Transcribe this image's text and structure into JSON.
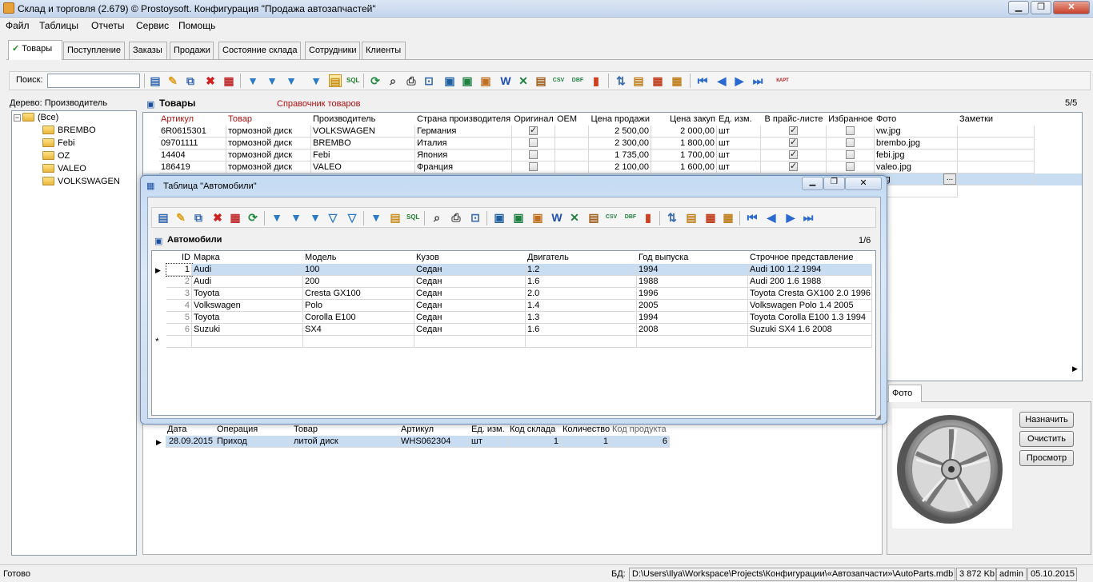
{
  "window": {
    "title": "Склад и торговля (2.679) © Prostoysoft. Конфигурация \"Продажа автозапчастей\""
  },
  "menu": [
    "Файл",
    "Таблицы",
    "Отчеты",
    "Сервис",
    "Помощь"
  ],
  "tabs": [
    "Товары",
    "Поступление",
    "Заказы",
    "Продажи",
    "Состояние склада",
    "Сотрудники",
    "Клиенты"
  ],
  "search": {
    "label": "Поиск:",
    "value": ""
  },
  "tree": {
    "title": "Дерево: Производитель",
    "root": "(Все)",
    "items": [
      "BREMBO",
      "Febi",
      "OZ",
      "VALEO",
      "VOLKSWAGEN"
    ]
  },
  "products": {
    "title": "Товары",
    "subtitle": "Справочник товаров",
    "count": "5/5",
    "columns": [
      "Артикул",
      "Товар",
      "Производитель",
      "Страна производителя",
      "Оригинал",
      "OEM",
      "Цена продажи",
      "Цена закуп",
      "Ед. изм.",
      "В прайс-листе",
      "Избранное",
      "Фото",
      "Заметки"
    ],
    "rows": [
      {
        "article": "6R0615301",
        "product": "тормозной диск",
        "maker": "VOLKSWAGEN",
        "country": "Германия",
        "original": true,
        "oem": "",
        "price": "2 500,00",
        "cost": "2 000,00",
        "unit": "шт",
        "pricelist": true,
        "fav": false,
        "photo": "vw.jpg",
        "notes": ""
      },
      {
        "article": "09701111",
        "product": "тормозной диск",
        "maker": "BREMBO",
        "country": "Италия",
        "original": false,
        "oem": "",
        "price": "2 300,00",
        "cost": "1 800,00",
        "unit": "шт",
        "pricelist": true,
        "fav": false,
        "photo": "brembo.jpg",
        "notes": ""
      },
      {
        "article": "14404",
        "product": "тормозной диск",
        "maker": "Febi",
        "country": "Япония",
        "original": false,
        "oem": "",
        "price": "1 735,00",
        "cost": "1 700,00",
        "unit": "шт",
        "pricelist": true,
        "fav": false,
        "photo": "febi.jpg",
        "notes": ""
      },
      {
        "article": "186419",
        "product": "тормозной диск",
        "maker": "VALEO",
        "country": "Франция",
        "original": false,
        "oem": "",
        "price": "2 100,00",
        "cost": "1 600,00",
        "unit": "шт",
        "pricelist": true,
        "fav": false,
        "photo": "valeo.jpg",
        "notes": ""
      },
      {
        "photo": ".jpg"
      }
    ],
    "browse_button": "..."
  },
  "dialog": {
    "title": "Таблица \"Автомобили\"",
    "grid_title": "Автомобили",
    "count": "1/6",
    "columns": [
      "ID",
      "Марка",
      "Модель",
      "Кузов",
      "Двигатель",
      "Год выпуска",
      "Строчное представление"
    ],
    "rows": [
      {
        "id": "1",
        "brand": "Audi",
        "model": "100",
        "body": "Седан",
        "engine": "1.2",
        "year": "1994",
        "repr": "Audi 100 1.2 1994"
      },
      {
        "id": "2",
        "brand": "Audi",
        "model": "200",
        "body": "Седан",
        "engine": "1.6",
        "year": "1988",
        "repr": "Audi 200 1.6 1988"
      },
      {
        "id": "3",
        "brand": "Toyota",
        "model": "Cresta GX100",
        "body": "Седан",
        "engine": "2.0",
        "year": "1996",
        "repr": "Toyota Cresta GX100 2.0 1996"
      },
      {
        "id": "4",
        "brand": "Volkswagen",
        "model": "Polo",
        "body": "Седан",
        "engine": "1.4",
        "year": "2005",
        "repr": "Volkswagen Polo 1.4 2005"
      },
      {
        "id": "5",
        "brand": "Toyota",
        "model": "Corolla E100",
        "body": "Седан",
        "engine": "1.3",
        "year": "1994",
        "repr": "Toyota Corolla E100 1.3 1994"
      },
      {
        "id": "6",
        "brand": "Suzuki",
        "model": "SX4",
        "body": "Седан",
        "engine": "1.6",
        "year": "2008",
        "repr": "Suzuki SX4 1.6 2008"
      }
    ],
    "new_row_marker": "*"
  },
  "movements": {
    "columns": [
      "Дата",
      "Операция",
      "Товар",
      "Артикул",
      "Ед. изм.",
      "Код склада",
      "Количество",
      "Код продукта"
    ],
    "rows": [
      {
        "date": "28.09.2015",
        "op": "Приход",
        "product": "литой диск",
        "article": "WHS062304",
        "unit": "шт",
        "store": "1",
        "qty": "1",
        "code": "6"
      }
    ]
  },
  "photo": {
    "tab": "Фото",
    "buttons": [
      "Назначить",
      "Очистить",
      "Просмотр"
    ]
  },
  "status": {
    "ready": "Готово",
    "db_label": "БД:",
    "db_path": "D:\\Users\\Ilya\\Workspace\\Projects\\Конфигурации\\«Автозапчасти»\\AutoParts.mdb",
    "size": "3 872 Kb",
    "user": "admin",
    "date": "05.10.2015"
  },
  "colors": {
    "selection": "#c8dcf2",
    "header_red": "#b01010",
    "accent": "#1a4fa0"
  }
}
